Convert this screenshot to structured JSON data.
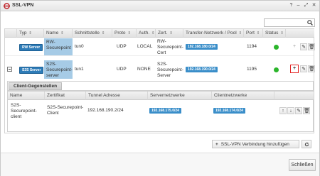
{
  "window": {
    "title": "SSL-VPN",
    "controls": [
      "?",
      "–",
      "⤢",
      "✕"
    ]
  },
  "search": {
    "value": "",
    "icon": "search-icon"
  },
  "table": {
    "columns": [
      "Typ",
      "Name",
      "Schnittstelle",
      "Proto",
      "Auth.",
      "Zert.",
      "Transfer-Netzwerk / Pool",
      "Port",
      "Status"
    ],
    "sort_marker": "⇕",
    "rows": [
      {
        "type": "RW Server",
        "name": [
          "RW-",
          "Securepoint"
        ],
        "interface": "tun0",
        "proto": "UDP",
        "auth": "LOCAL",
        "cert": [
          "RW-",
          "Securepoint-",
          "Cert"
        ],
        "transfer": "192.168.180.0/24",
        "port": "1194",
        "status": "online"
      },
      {
        "type": "S2S Server",
        "name": [
          "S2S-",
          "Securepoint-",
          "server"
        ],
        "interface": "tun1",
        "proto": "UDP",
        "auth": "NONE",
        "cert": [
          "S2S-",
          "Securepoint-",
          "Server"
        ],
        "transfer": "192.168.190.0/24",
        "port": "1195",
        "status": "online"
      }
    ],
    "row_actions": [
      "+",
      "✎",
      "🗑"
    ]
  },
  "client_panel": {
    "tab": "Client-Gegenstellen",
    "columns": [
      "Name",
      "Zertifikat",
      "Tunnel Adresse",
      "Servernetzwerke",
      "Clientnetzwerke"
    ],
    "row": {
      "name": [
        "S2S-",
        "Securepoint-",
        "client"
      ],
      "cert": [
        "S2S-Securepoint-",
        "Client"
      ],
      "tunnel": "192.168.190.2/24",
      "server_net": "192.168.175.0/24",
      "client_net": "192.168.174.0/24"
    },
    "row_actions": [
      "↑",
      "↓",
      "✎",
      "🗑"
    ]
  },
  "toolbar": {
    "add_label": "SSL-VPN Verbindung hinzufügen",
    "add_icon": "plus-icon",
    "refresh_icon": "refresh-icon"
  },
  "footer": {
    "close_label": "Schließen"
  },
  "colors": {
    "badge_blue": "#2e7cb8",
    "row_highlight": "#a6cbe6",
    "status_green": "#2bb52b",
    "highlight_border": "#e32424"
  }
}
